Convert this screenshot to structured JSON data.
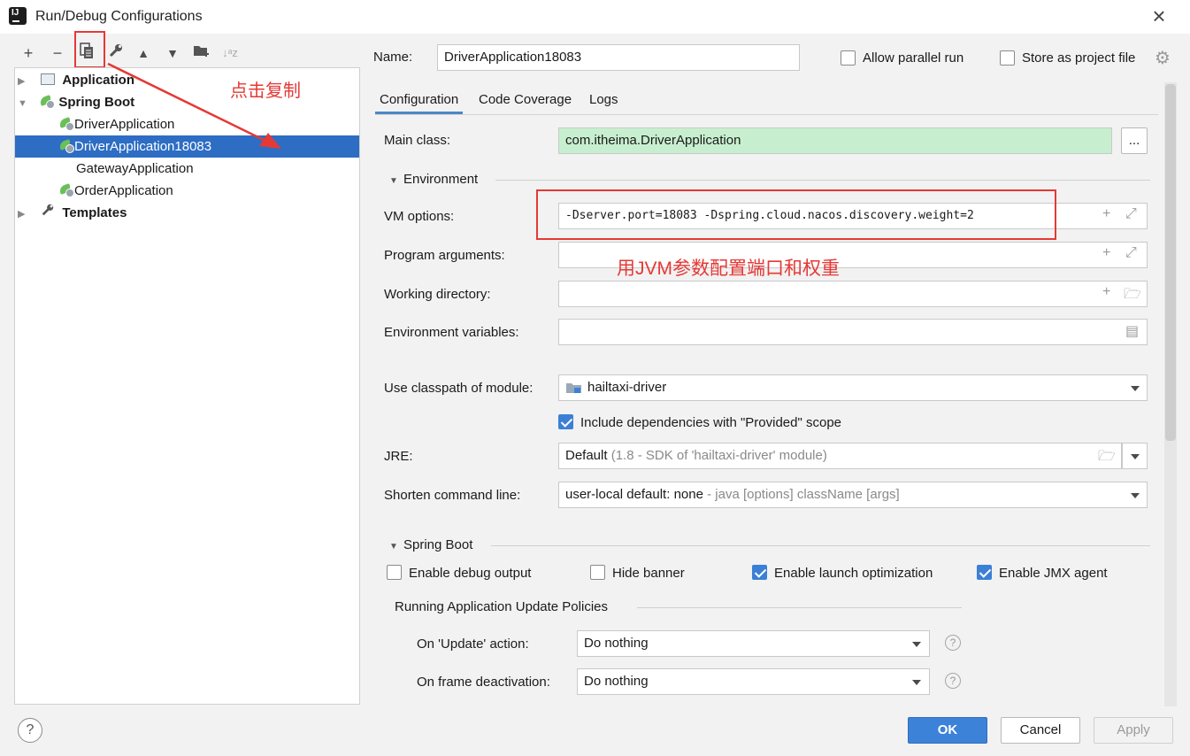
{
  "window": {
    "title": "Run/Debug Configurations",
    "close_glyph": "×"
  },
  "toolbar": {
    "icons": [
      "add-icon",
      "remove-icon",
      "copy-icon",
      "wrench-icon",
      "move-up-icon",
      "move-down-icon",
      "new-folder-icon",
      "sort-icon"
    ],
    "glyphs": {
      "add": "+",
      "remove": "−",
      "up": "▲",
      "down": "▼",
      "sort": "↓ᵃz"
    }
  },
  "tree": {
    "application": "Application",
    "spring_boot": "Spring Boot",
    "items": [
      "DriverApplication",
      "DriverApplication18083",
      "GatewayApplication",
      "OrderApplication"
    ],
    "templates": "Templates"
  },
  "annotations": {
    "copy": "点击复制",
    "jvm": "用JVM参数配置端口和权重",
    "color": "#e53935"
  },
  "header": {
    "name_label": "Name:",
    "name_value": "DriverApplication18083",
    "allow_parallel": "Allow parallel run",
    "store_project": "Store as project file"
  },
  "tabs": [
    "Configuration",
    "Code Coverage",
    "Logs"
  ],
  "config": {
    "main_class_label": "Main class:",
    "main_class_value": "com.itheima.DriverApplication",
    "browse": "...",
    "environment_section": "Environment",
    "vm_options_label": "VM options:",
    "vm_options_value": "-Dserver.port=18083 -Dspring.cloud.nacos.discovery.weight=2",
    "program_args_label": "Program arguments:",
    "working_dir_label": "Working directory:",
    "env_vars_label": "Environment variables:",
    "classpath_label": "Use classpath of module:",
    "classpath_value": "hailtaxi-driver",
    "include_provided": "Include dependencies with \"Provided\" scope",
    "jre_label": "JRE:",
    "jre_value": "Default",
    "jre_detail": "(1.8 - SDK of 'hailtaxi-driver' module)",
    "shorten_label": "Shorten command line:",
    "shorten_value": "user-local default: none",
    "shorten_detail": "- java [options] className [args]"
  },
  "spring_boot": {
    "section": "Spring Boot",
    "debug_output": "Enable debug output",
    "hide_banner": "Hide banner",
    "launch_opt": "Enable launch optimization",
    "jmx_agent": "Enable JMX agent",
    "policies_title": "Running Application Update Policies",
    "update_label": "On 'Update' action:",
    "update_value": "Do nothing",
    "frame_label": "On frame deactivation:",
    "frame_value": "Do nothing"
  },
  "footer": {
    "help": "?",
    "ok": "OK",
    "cancel": "Cancel",
    "apply": "Apply"
  },
  "colors": {
    "selection": "#2d6dc4",
    "main_class_bg": "#c7efcf",
    "ok_button": "#3d82d9"
  }
}
